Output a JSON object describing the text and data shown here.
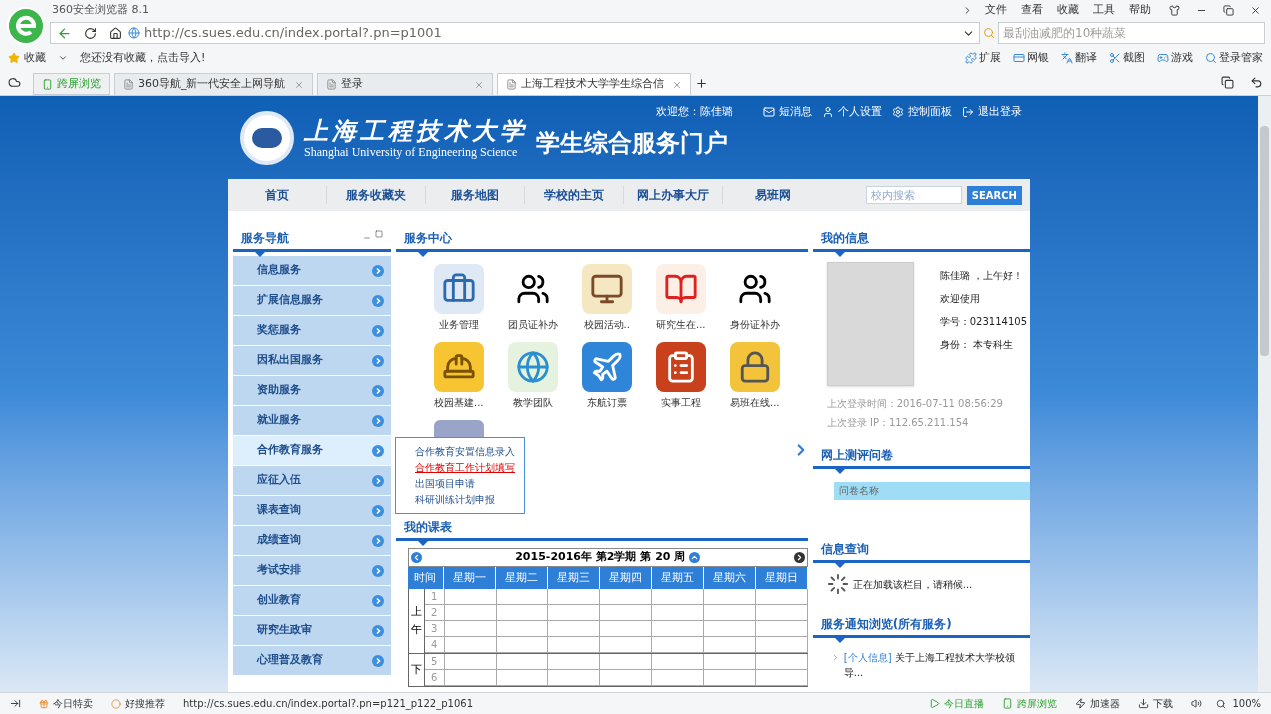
{
  "browser": {
    "title": "360安全浏览器 8.1",
    "menu": [
      "文件",
      "查看",
      "收藏",
      "工具",
      "帮助"
    ],
    "url": "http://cs.sues.edu.cn/index.portal?.pn=p1001",
    "search_placeholder": "最刮油减肥的10种蔬菜",
    "bookmarks": {
      "label": "收藏",
      "hint": "您还没有收藏，点击导入!"
    },
    "extensions": [
      "扩展",
      "网银",
      "翻译",
      "截图",
      "游戏",
      "登录管家"
    ],
    "cross_screen": "跨屏浏览",
    "tabs": [
      {
        "label": "360导航_新一代安全上网导航",
        "selected": false
      },
      {
        "label": "登录",
        "selected": false
      },
      {
        "label": "上海工程技术大学学生综合信",
        "selected": true
      }
    ]
  },
  "header": {
    "school_cn": "上海工程技术大学",
    "school_en": "Shanghai University of Engineering Science",
    "portal": "学生综合服务门户",
    "welcome": "欢迎您：陈佳璐",
    "links": [
      "短消息",
      "个人设置",
      "控制面板",
      "退出登录"
    ]
  },
  "nav": {
    "items": [
      "首页",
      "服务收藏夹",
      "服务地图",
      "学校的主页",
      "网上办事大厅",
      "易班网"
    ],
    "search_placeholder": "校内搜索",
    "search_button": "SEARCH"
  },
  "sidebar": {
    "title": "服务导航",
    "items": [
      {
        "label": "信息服务",
        "selected": false
      },
      {
        "label": "扩展信息服务",
        "selected": false
      },
      {
        "label": "奖惩服务",
        "selected": false
      },
      {
        "label": "因私出国服务",
        "selected": false
      },
      {
        "label": "资助服务",
        "selected": false
      },
      {
        "label": "就业服务",
        "selected": false
      },
      {
        "label": "合作教育服务",
        "selected": true
      },
      {
        "label": "应征入伍",
        "selected": false
      },
      {
        "label": "课表查询",
        "selected": false
      },
      {
        "label": "成绩查询",
        "selected": false
      },
      {
        "label": "考试安排",
        "selected": false
      },
      {
        "label": "创业教育",
        "selected": false
      },
      {
        "label": "研究生政审",
        "selected": false
      },
      {
        "label": "心理普及教育",
        "selected": false
      }
    ],
    "submenu": [
      {
        "label": "合作教育安置信息录入",
        "selected": false
      },
      {
        "label": "合作教育工作计划填写",
        "selected": true
      },
      {
        "label": "出国项目申请",
        "selected": false
      },
      {
        "label": "科研训练计划申报",
        "selected": false
      }
    ]
  },
  "service_center": {
    "title": "服务中心",
    "apps": [
      "业务管理",
      "团员证补办",
      "校园活动..",
      "研究生在...",
      "身份证补办",
      "校园基建...",
      "教学团队",
      "东航订票",
      "实事工程",
      "易班在线..."
    ]
  },
  "timetable": {
    "title": "我的课表",
    "week": "2015-2016年 第2学期 第 20 周",
    "columns": [
      "时间",
      "星期一",
      "星期二",
      "星期三",
      "星期四",
      "星期五",
      "星期六",
      "星期日"
    ],
    "groups": [
      {
        "label": "上午",
        "periods": [
          "1",
          "2",
          "3",
          "4"
        ]
      },
      {
        "label": "下",
        "periods": [
          "5",
          "6"
        ]
      }
    ]
  },
  "my_info": {
    "title": "我的信息",
    "greeting": "陈佳璐 ，上午好！",
    "welcome": "欢迎使用",
    "student_id": "学号：023114105",
    "identity": "身份： 本专科生",
    "last_login": "上次登录时间：2016-07-11 08:56:29",
    "last_ip": "上次登录 IP：112.65.211.154"
  },
  "survey": {
    "title": "网上测评问卷",
    "column": "问卷名称"
  },
  "info_query": {
    "title": "信息查询",
    "loading": "正在加载该栏目，请稍候..."
  },
  "notices": {
    "title": "服务通知浏览(所有服务)",
    "items": [
      {
        "tag": "[个人信息]",
        "text": "关于上海工程技术大学校领导..."
      }
    ]
  },
  "status_bar": {
    "left": [
      "今日特卖",
      "好搜推荐"
    ],
    "url": "http://cs.sues.edu.cn/index.portal?.pn=p121_p122_p1061",
    "right": [
      "今日直播",
      "跨屏浏览",
      "加速器",
      "下载"
    ],
    "zoom": "100%"
  }
}
